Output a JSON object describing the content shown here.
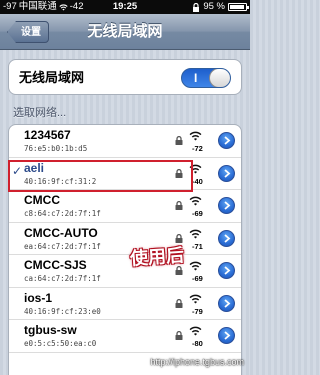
{
  "status_bar": {
    "signal_strength": "-97",
    "carrier": "中国联通",
    "wifi_dbm": "-42",
    "time": "19:25",
    "battery_percent": "95 %",
    "battery_level": 0.95
  },
  "nav": {
    "back_label": "设置",
    "title": "无线局域网"
  },
  "wifi_toggle": {
    "label": "无线局域网",
    "state_text": "I"
  },
  "section_header": "选取网络...",
  "networks": [
    {
      "name": "1234567",
      "mac": "76:e5:b0:1b:d5",
      "signal": "-72",
      "selected": false
    },
    {
      "name": "aeli",
      "mac": "40:16:9f:cf:31:2",
      "signal": "-40",
      "selected": true
    },
    {
      "name": "CMCC",
      "mac": "c8:64:c7:2d:7f:1f",
      "signal": "-69",
      "selected": false
    },
    {
      "name": "CMCC-AUTO",
      "mac": "ea:64:c7:2d:7f:1f",
      "signal": "-71",
      "selected": false
    },
    {
      "name": "CMCC-SJS",
      "mac": "ca:64:c7:2d:7f:1f",
      "signal": "-69",
      "selected": false
    },
    {
      "name": "ios-1",
      "mac": "40:16:9f:cf:23:e0",
      "signal": "-79",
      "selected": false
    },
    {
      "name": "tgbus-sw",
      "mac": "e0:5:c5:50:ea:c0",
      "signal": "-80",
      "selected": false
    }
  ],
  "checkmark": "✓",
  "watermark": "使用后",
  "footer_url": "http://iphone.tgbus.com",
  "colors": {
    "accent_blue": "#2a6cd4",
    "highlight_red": "#d0202e",
    "selected_text": "#2c4a8a"
  }
}
